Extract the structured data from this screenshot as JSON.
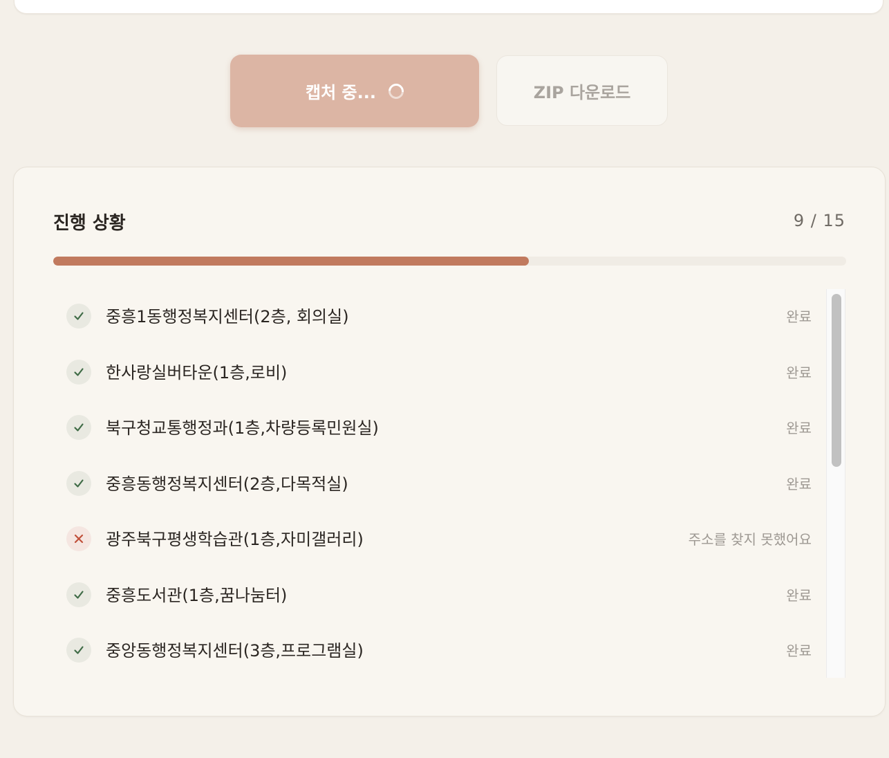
{
  "actions": {
    "capture_label": "캡처 중...",
    "zip_label": "ZIP 다운로드"
  },
  "progress": {
    "title": "진행 상황",
    "count_text": "9 / 15",
    "completed": 9,
    "total": 15,
    "fill_fraction": 0.6
  },
  "colors": {
    "accent": "#c17a5e",
    "success": "#3f6b46",
    "error": "#c0503a"
  },
  "items": [
    {
      "label": "중흥1동행정복지센터(2층, 회의실)",
      "status": "완료",
      "state": "done",
      "icon": "check-icon"
    },
    {
      "label": "한사랑실버타운(1층,로비)",
      "status": "완료",
      "state": "done",
      "icon": "check-icon"
    },
    {
      "label": "북구청교통행정과(1층,차량등록민원실)",
      "status": "완료",
      "state": "done",
      "icon": "check-icon"
    },
    {
      "label": "중흥동행정복지센터(2층,다목적실)",
      "status": "완료",
      "state": "done",
      "icon": "check-icon"
    },
    {
      "label": "광주북구평생학습관(1층,자미갤러리)",
      "status": "주소를 찾지 못했어요",
      "state": "fail",
      "icon": "x-icon"
    },
    {
      "label": "중흥도서관(1층,꿈나눔터)",
      "status": "완료",
      "state": "done",
      "icon": "check-icon"
    },
    {
      "label": "중앙동행정복지센터(3층,프로그램실)",
      "status": "완료",
      "state": "done",
      "icon": "check-icon"
    }
  ]
}
